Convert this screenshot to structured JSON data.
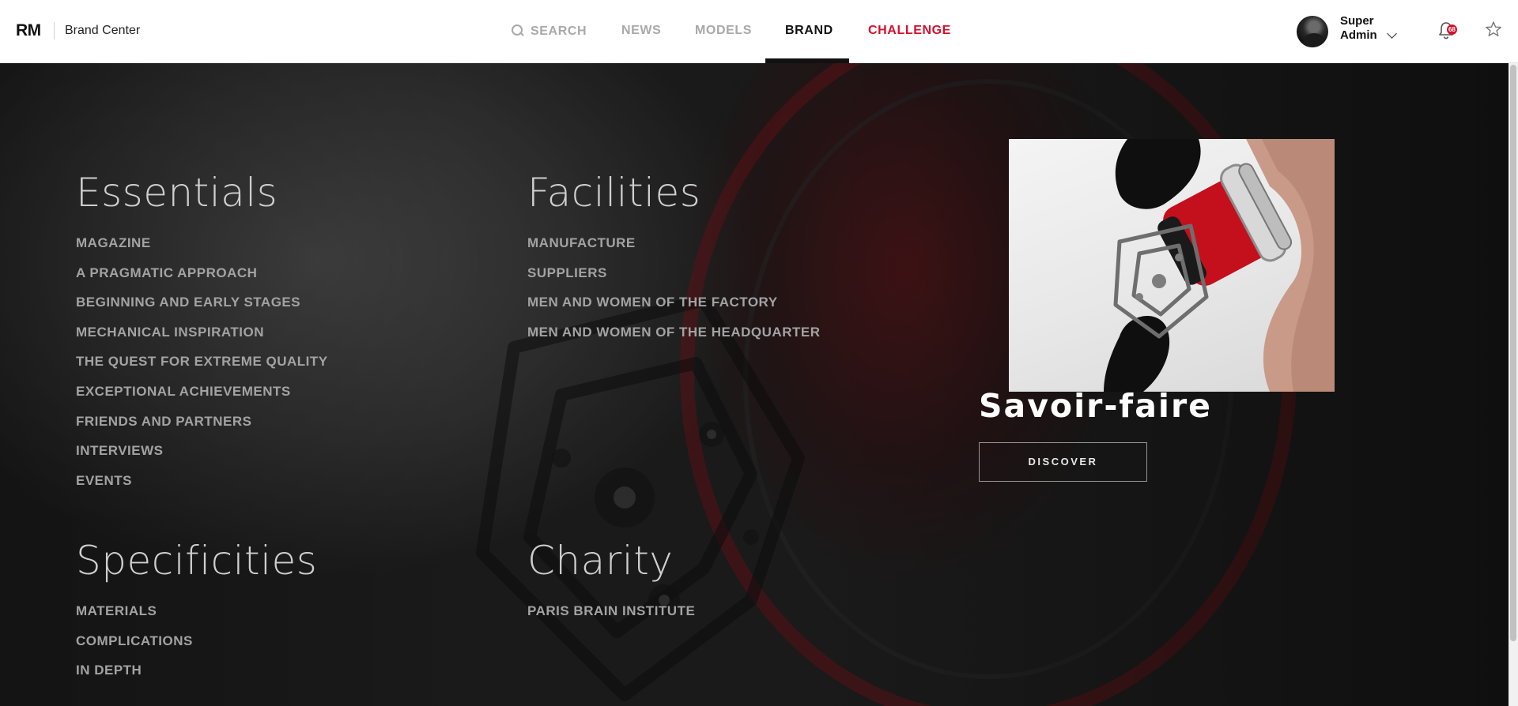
{
  "header": {
    "logo": "RM",
    "section_title": "Brand Center",
    "nav": {
      "search": "SEARCH",
      "news": "NEWS",
      "models": "MODELS",
      "brand": "BRAND",
      "challenge": "CHALLENGE"
    },
    "active_nav": "brand",
    "user": {
      "name": "Super Admin"
    },
    "notifications": {
      "count": "68"
    }
  },
  "menu": {
    "essentials": {
      "title": "Essentials",
      "links": [
        "MAGAZINE",
        "A PRAGMATIC APPROACH",
        "BEGINNING AND EARLY STAGES",
        "MECHANICAL INSPIRATION",
        "THE QUEST FOR EXTREME QUALITY",
        "EXCEPTIONAL ACHIEVEMENTS",
        "FRIENDS AND PARTNERS",
        "INTERVIEWS",
        "EVENTS"
      ]
    },
    "facilities": {
      "title": "Facilities",
      "links": [
        "MANUFACTURE",
        "SUPPLIERS",
        "MEN AND WOMEN OF THE FACTORY",
        "MEN AND WOMEN OF THE HEADQUARTER"
      ]
    },
    "specificities": {
      "title": "Specificities",
      "links": [
        "MATERIALS",
        "COMPLICATIONS",
        "IN DEPTH"
      ]
    },
    "charity": {
      "title": "Charity",
      "links": [
        "PARIS BRAIN INSTITUTE"
      ]
    }
  },
  "feature": {
    "title": "Savoir-faire",
    "button": "DISCOVER"
  },
  "colors": {
    "accent": "#d2102c",
    "nav_inactive": "#a9a9a9",
    "nav_active": "#111111",
    "menu_link": "#a3a3a3",
    "menu_heading": "#cfcfcf"
  }
}
